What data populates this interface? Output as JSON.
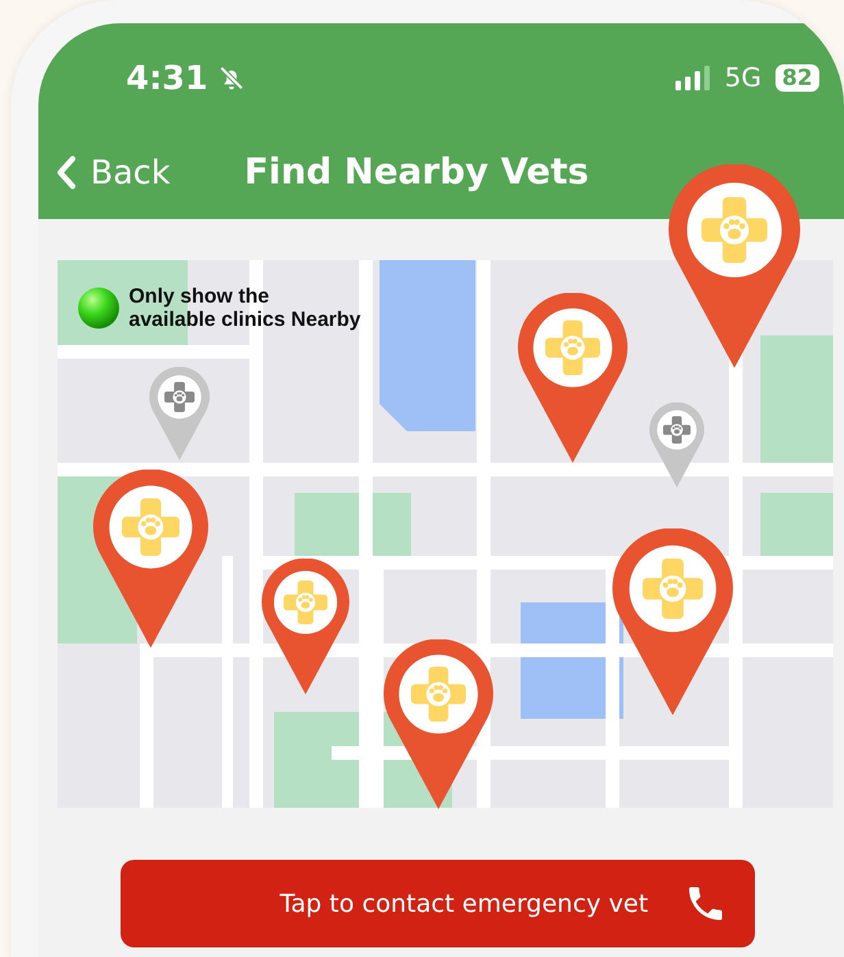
{
  "status_bar": {
    "time": "4:31",
    "network": "5G",
    "battery": "82"
  },
  "nav": {
    "back": "Back",
    "title": "Find Nearby Vets"
  },
  "map": {
    "legend": "Only show the\navailable clinics Nearby",
    "pins": [
      {
        "kind": "available"
      },
      {
        "kind": "available"
      },
      {
        "kind": "unavailable"
      },
      {
        "kind": "unavailable"
      },
      {
        "kind": "available"
      },
      {
        "kind": "available"
      },
      {
        "kind": "available"
      },
      {
        "kind": "available"
      }
    ]
  },
  "emergency_button": {
    "label": "Tap to contact emergency vet"
  }
}
